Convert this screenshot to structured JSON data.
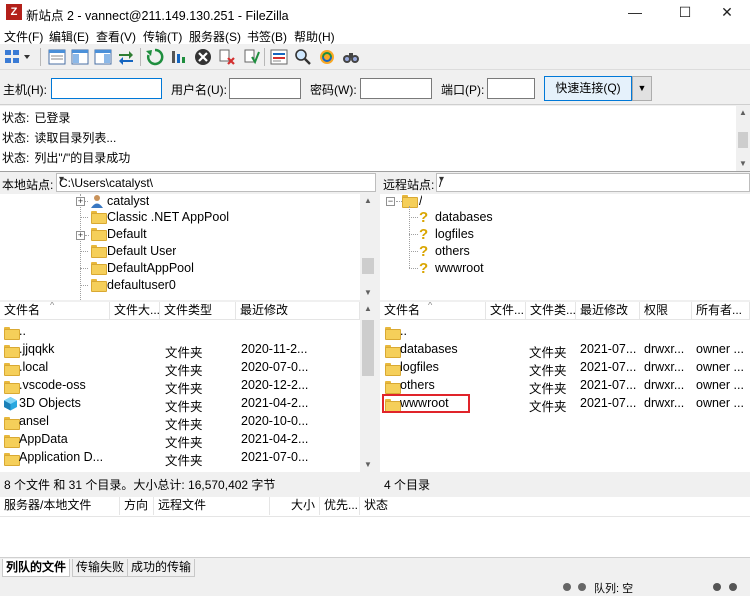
{
  "window": {
    "title": "新站点 2 - vannect@211.149.130.251 - FileZilla",
    "app_icon": "Z",
    "minimize_glyph": "—",
    "maximize_glyph": "☐",
    "close_glyph": "✕"
  },
  "menu": [
    "文件(F)",
    "编辑(E)",
    "查看(V)",
    "传输(T)",
    "服务器(S)",
    "书签(B)",
    "帮助(H)"
  ],
  "toolbar_icons": [
    "site-manager-icon",
    "toggle-log-icon",
    "toggle-local-tree-icon",
    "toggle-remote-tree-icon",
    "transfer-queue-icon",
    "refresh-icon",
    "process-queue-icon",
    "cancel-icon",
    "disconnect-icon",
    "reconnect-icon",
    "directory-filter-icon",
    "directory-compare-icon",
    "sync-browse-icon",
    "find-files-icon"
  ],
  "quickconnect": {
    "host_label": "主机(H):",
    "user_label": "用户名(U):",
    "pass_label": "密码(W):",
    "port_label": "端口(P):",
    "host_value": "",
    "user_value": "",
    "pass_value": "",
    "port_value": "",
    "connect_label": "快速连接(Q)"
  },
  "log": [
    {
      "label": "状态:",
      "text": "已登录"
    },
    {
      "label": "状态:",
      "text": "读取目录列表..."
    },
    {
      "label": "状态:",
      "text": "列出\"/\"的目录成功"
    }
  ],
  "local": {
    "path_label": "本地站点:",
    "path": "C:\\Users\\catalyst\\",
    "tree": [
      "catalyst",
      "Classic .NET AppPool",
      "Default",
      "Default User",
      "DefaultAppPool",
      "defaultuser0"
    ],
    "columns": [
      "文件名",
      "文件大...",
      "文件类型",
      "最近修改"
    ],
    "files": [
      {
        "name": "..",
        "type": "",
        "modified": ""
      },
      {
        "name": ".jjqqkk",
        "type": "文件夹",
        "modified": "2020-11-2..."
      },
      {
        "name": ".local",
        "type": "文件夹",
        "modified": "2020-07-0..."
      },
      {
        "name": ".vscode-oss",
        "type": "文件夹",
        "modified": "2020-12-2..."
      },
      {
        "name": "3D Objects",
        "type": "文件夹",
        "modified": "2021-04-2..."
      },
      {
        "name": "ansel",
        "type": "文件夹",
        "modified": "2020-10-0..."
      },
      {
        "name": "AppData",
        "type": "文件夹",
        "modified": "2021-04-2..."
      },
      {
        "name": "Application D...",
        "type": "文件夹",
        "modified": "2021-07-0..."
      }
    ],
    "status": "8 个文件 和 31 个目录。大小总计: 16,570,402 字节"
  },
  "remote": {
    "path_label": "远程站点:",
    "path": "/",
    "tree_root": "/",
    "tree": [
      "databases",
      "logfiles",
      "others",
      "wwwroot"
    ],
    "columns": [
      "文件名",
      "文件...",
      "文件类...",
      "最近修改",
      "权限",
      "所有者..."
    ],
    "files": [
      {
        "name": "..",
        "type": "",
        "modified": "",
        "perm": "",
        "owner": ""
      },
      {
        "name": "databases",
        "type": "文件夹",
        "modified": "2021-07...",
        "perm": "drwxr...",
        "owner": "owner ..."
      },
      {
        "name": "logfiles",
        "type": "文件夹",
        "modified": "2021-07...",
        "perm": "drwxr...",
        "owner": "owner ..."
      },
      {
        "name": "others",
        "type": "文件夹",
        "modified": "2021-07...",
        "perm": "drwxr...",
        "owner": "owner ..."
      },
      {
        "name": "wwwroot",
        "type": "文件夹",
        "modified": "2021-07...",
        "perm": "drwxr...",
        "owner": "owner ..."
      }
    ],
    "status": "4 个目录"
  },
  "queue": {
    "columns": [
      "服务器/本地文件",
      "方向",
      "远程文件",
      "大小",
      "优先...",
      "状态"
    ]
  },
  "tabs": [
    "列队的文件",
    "传输失败",
    "成功的传输"
  ],
  "bottom_status": "队列: 空",
  "colors": {
    "highlight": "#e0242a",
    "focus": "#0078d7"
  }
}
